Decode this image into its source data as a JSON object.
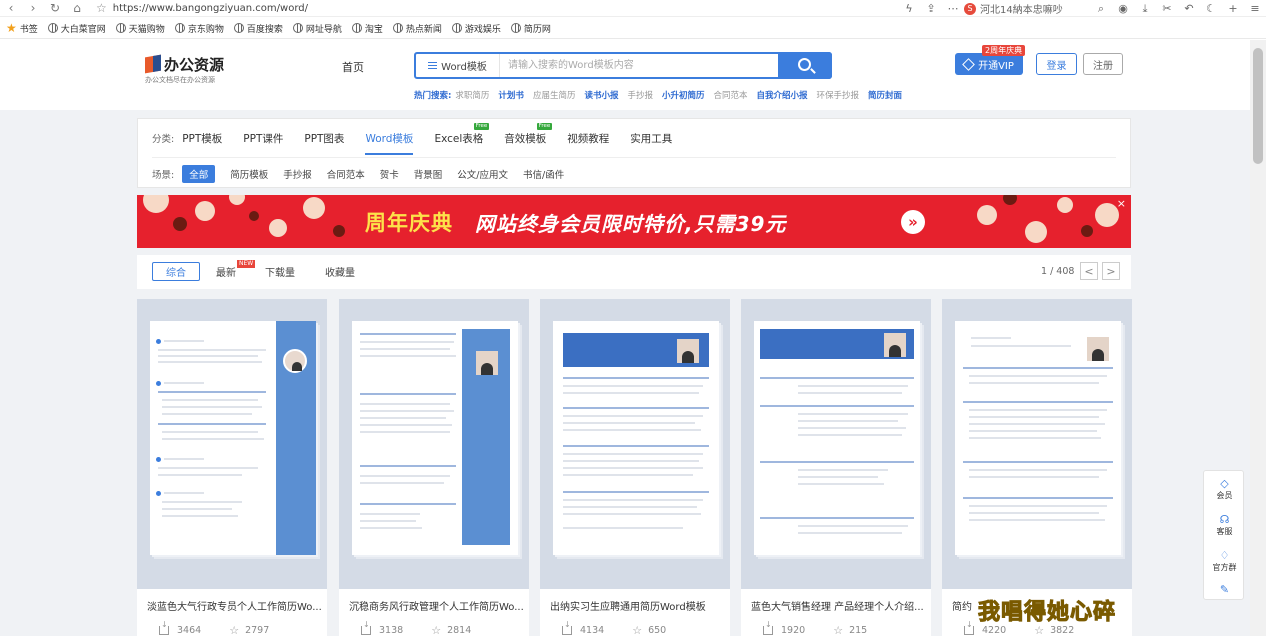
{
  "browser": {
    "url": "https://www.bangongziyuan.com/word/",
    "search_hint": "河北14納本忠嘛吵",
    "bookmarks": [
      "书签",
      "大白菜官网",
      "天猫购物",
      "京东购物",
      "百度搜索",
      "网址导航",
      "淘宝",
      "热点新闻",
      "游戏娱乐",
      "简历网"
    ]
  },
  "header": {
    "logo_name": "办公资源",
    "logo_sub": "办公文档尽在办公资源",
    "home": "首页",
    "search_category": "Word模板",
    "search_placeholder": "请输入搜索的Word模板内容",
    "hot_label": "热门搜索:",
    "hot": [
      {
        "t": "求职简历",
        "hl": false
      },
      {
        "t": "计划书",
        "hl": true
      },
      {
        "t": "应届生简历",
        "hl": false
      },
      {
        "t": "读书小报",
        "hl": true
      },
      {
        "t": "手抄报",
        "hl": false
      },
      {
        "t": "小升初简历",
        "hl": true
      },
      {
        "t": "合同范本",
        "hl": false
      },
      {
        "t": "自我介绍小报",
        "hl": true
      },
      {
        "t": "环保手抄报",
        "hl": false
      },
      {
        "t": "简历封面",
        "hl": true
      }
    ],
    "vip_badge": "2周年庆典",
    "vip": "开通VIP",
    "login": "登录",
    "register": "注册"
  },
  "categories": {
    "label": "分类:",
    "items": [
      "PPT模板",
      "PPT课件",
      "PPT图表",
      "Word模板",
      "Excel表格",
      "音效模板",
      "视频教程",
      "实用工具"
    ],
    "free_tag": "Free",
    "scene_label": "场景:",
    "scenes": [
      "全部",
      "简历模板",
      "手抄报",
      "合同范本",
      "贺卡",
      "背景图",
      "公文/应用文",
      "书信/函件"
    ]
  },
  "banner": {
    "title": "周年庆典",
    "text": "网站终身会员限时特价,只需39元",
    "close": "×"
  },
  "sort": {
    "items": [
      "综合",
      "最新",
      "下载量",
      "收藏量"
    ],
    "new_tag": "NEW",
    "pager": "1 / 408",
    "prev": "<",
    "next": ">"
  },
  "cards": [
    {
      "title": "淡蓝色大气行政专员个人工作简历Wo...",
      "downloads": "3464",
      "favorites": "2797"
    },
    {
      "title": "沉稳商务风行政管理个人工作简历Wo...",
      "downloads": "3138",
      "favorites": "2814"
    },
    {
      "title": "出纳实习生应聘通用简历Word模板",
      "downloads": "4134",
      "favorites": "650"
    },
    {
      "title": "蓝色大气销售经理 产品经理个人介绍...",
      "downloads": "1920",
      "favorites": "215"
    },
    {
      "title": "简约",
      "downloads": "4220",
      "favorites": "3822"
    }
  ],
  "float_menu": [
    "会员",
    "客服",
    "官方群"
  ],
  "watermark": "我唱得她心碎"
}
